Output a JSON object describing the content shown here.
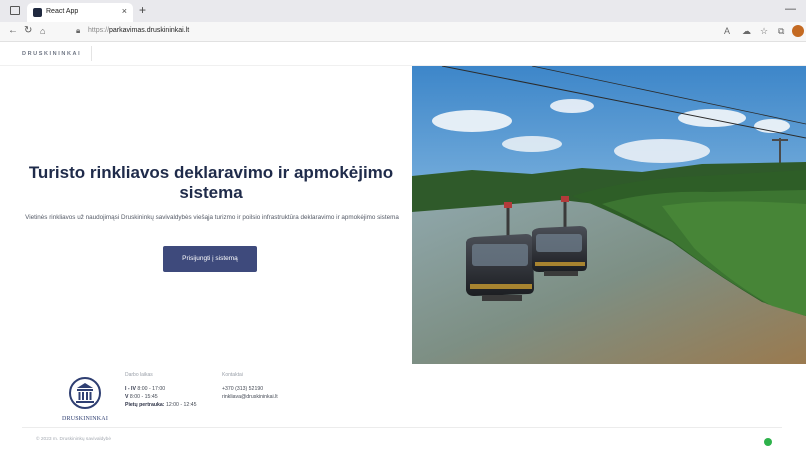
{
  "browser": {
    "tab_title": "React App",
    "tab_close": "×",
    "new_tab": "+",
    "url_scheme": "https://",
    "url_host": "parkavimas.druskininkai.lt",
    "window_min": "—",
    "icons": [
      "tab-actions-icon",
      "back-icon",
      "reload-icon",
      "home-icon",
      "lock-icon",
      "read-aloud-icon",
      "extensions-icon",
      "favorites-icon",
      "collections-icon",
      "profile-icon"
    ]
  },
  "header": {
    "brand": "DRUSKININKAI"
  },
  "hero": {
    "title_line1": "Turisto rinkliavos deklaravimo ir apmokėjimo",
    "title_line2": "sistema",
    "description": "Vietinės rinkliavos už naudojimąsi Druskininkų savivaldybės viešąja turizmo ir poilsio infrastruktūra deklaravimo ir apmokėjimo sistema",
    "login_button": "Prisijungti į sistemą"
  },
  "footer": {
    "logo_text": "DRUSKININKAI",
    "hours": {
      "heading": "Darbo laikas",
      "line1_label": "I - IV",
      "line1_value": "8:00 - 17:00",
      "line2_label": "V",
      "line2_value": "8:00 - 15:45",
      "line3_label": "Pietų pertrauka:",
      "line3_value": "12:00 - 12:45"
    },
    "contacts": {
      "heading": "Kontaktai",
      "phone": "+370 (313) 52190",
      "email": "rinkliava@druskininkai.lt"
    },
    "copyright": "© 2023 m. Druskininkų savivaldybė"
  },
  "colors": {
    "title": "#1f2b4a",
    "button": "#3e4a7c",
    "status_dot": "#2eb24b"
  }
}
